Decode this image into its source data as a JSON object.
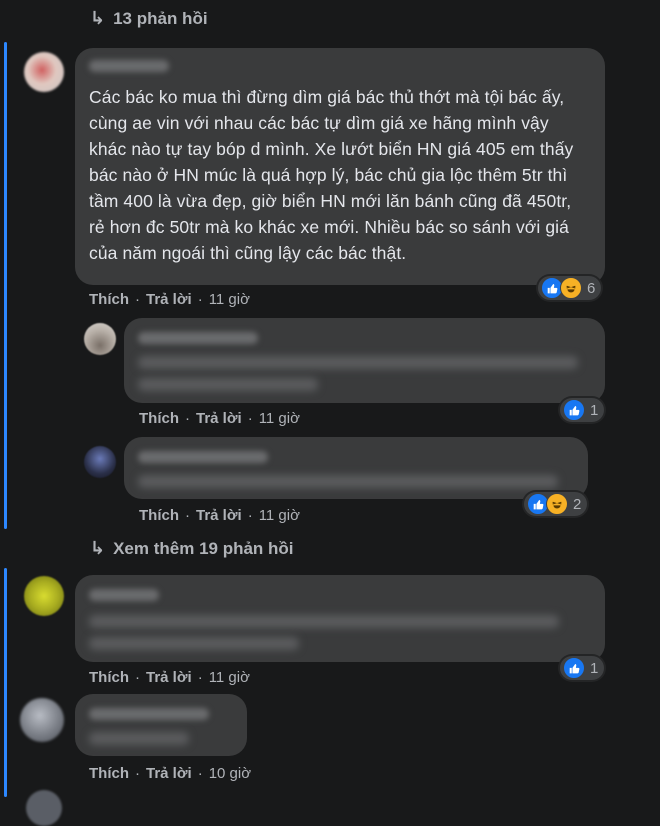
{
  "top_toggle": {
    "label": "13 phản hồi"
  },
  "more_toggle": {
    "label": "Xem thêm 19 phản hồi"
  },
  "comments": [
    {
      "text": "Các bác ko mua thì đừng dìm giá bác thủ thớt mà tội bác ấy, cùng ae vin với nhau các bác tự dìm giá xe hãng mình vậy khác nào tự tay bóp d mình. Xe lướt biển HN giá 405 em thấy bác nào ở HN múc là quá hợp lý, bác chủ gia lộc thêm 5tr thì tầm 400 là vừa đẹp, giờ biển HN mới lăn bánh cũng đã 450tr, rẻ hơn đc 50tr mà ko khác xe mới. Nhiều bác so sánh với giá của năm ngoái thì cũng lậy các bác thật.",
      "like": "Thích",
      "reply": "Trả lời",
      "time": "11 giờ",
      "reaction_count": "6"
    },
    {
      "like": "Thích",
      "reply": "Trả lời",
      "time": "11 giờ",
      "reaction_count": "1"
    },
    {
      "like": "Thích",
      "reply": "Trả lời",
      "time": "11 giờ",
      "reaction_count": "2"
    },
    {
      "like": "Thích",
      "reply": "Trả lời",
      "time": "11 giờ",
      "reaction_count": "1"
    },
    {
      "like": "Thích",
      "reply": "Trả lời",
      "time": "10 giờ"
    }
  ],
  "icons": {
    "reply_arrow": "reply-arrow-icon",
    "like": "like-reaction-icon",
    "haha": "haha-reaction-icon"
  },
  "colors": {
    "background": "#18191a",
    "bubble": "#3a3b3c",
    "thread_line": "#2d88ff",
    "like": "#1877f2",
    "haha": "#f7b125"
  }
}
